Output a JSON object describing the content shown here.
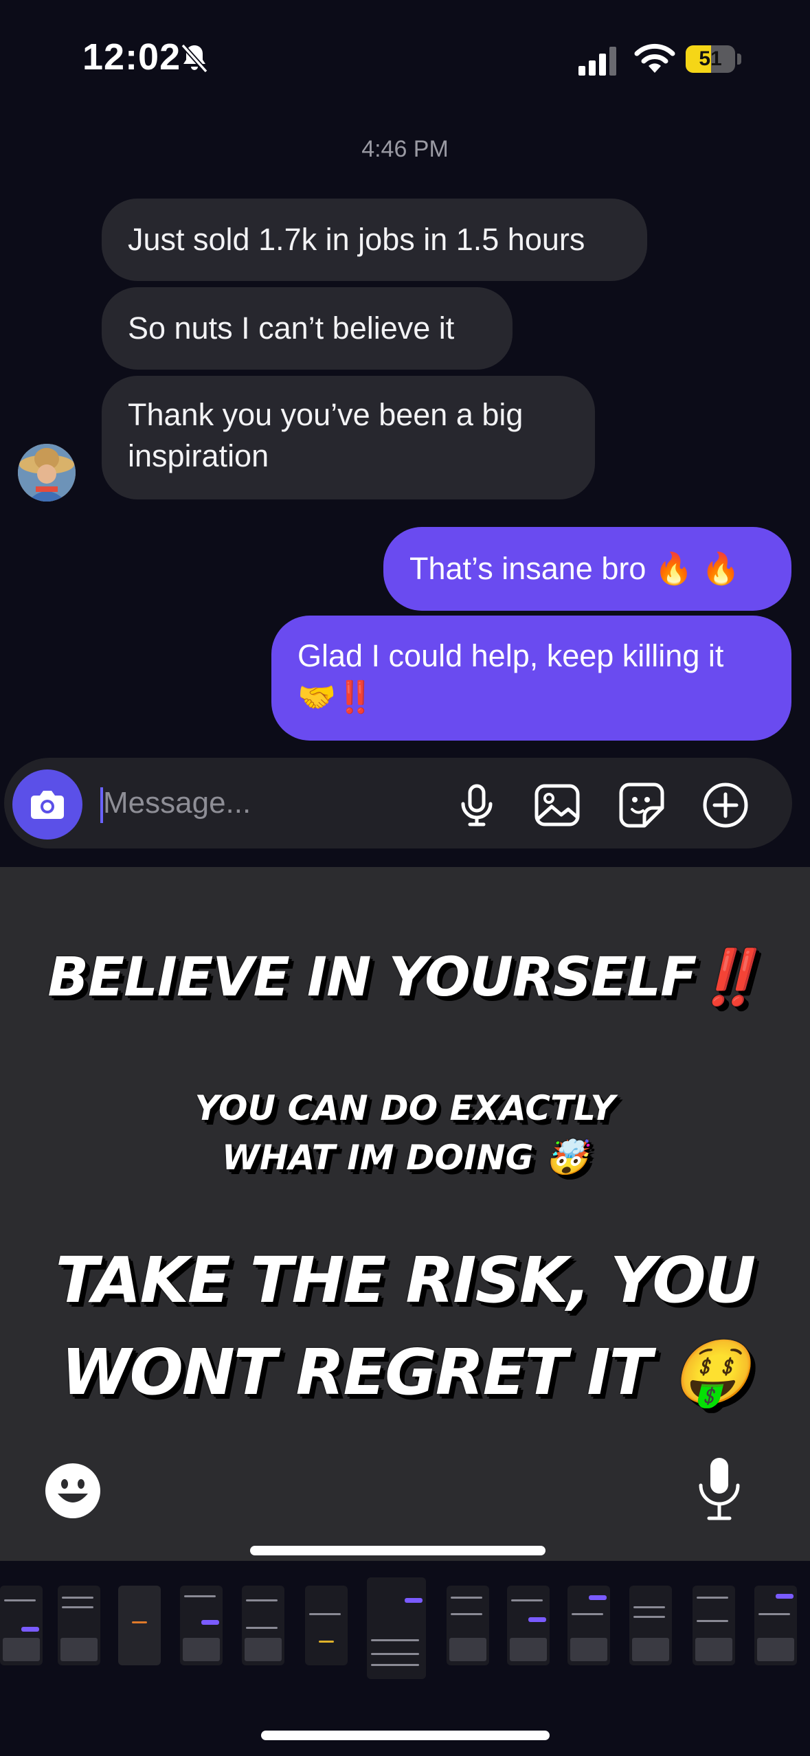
{
  "status_bar": {
    "time": "12:02",
    "battery": "51",
    "battery_level": 0.51,
    "battery_color": "#f5d617"
  },
  "chat": {
    "timestamp": "4:46 PM",
    "incoming": [
      "Just sold 1.7k in jobs in 1.5 hours",
      "So nuts I can’t believe it",
      "Thank you you’ve been a big",
      "inspiration"
    ],
    "outgoing": [
      "That’s insane bro 🔥 🔥",
      "Glad I could help, keep killing it",
      "🤝‼️"
    ],
    "outgoing_color": "#6a4bf0"
  },
  "composer": {
    "placeholder": "Message...",
    "icons": [
      "camera-icon",
      "microphone-icon",
      "image-icon",
      "sticker-icon",
      "plus-circle-icon"
    ]
  },
  "story": {
    "line1": "BELIEVE IN YOURSELF‼️",
    "line2a": "YOU CAN DO EXACTLY",
    "line2b": "WHAT IM DOING 🤯",
    "line3a": "TAKE THE RISK, YOU",
    "line3b": "WONT REGRET IT 🤑"
  }
}
